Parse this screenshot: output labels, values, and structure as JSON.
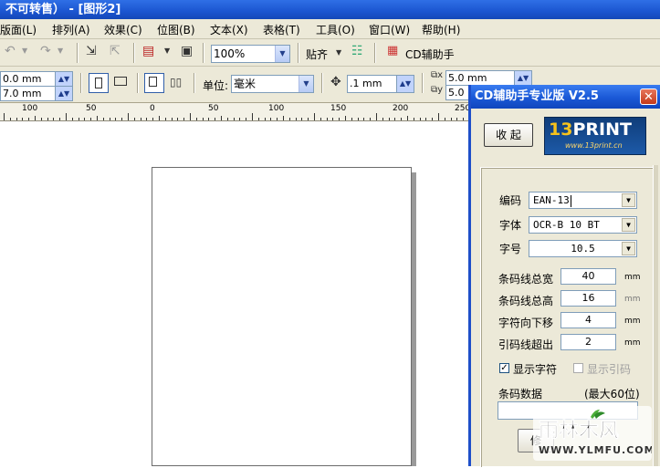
{
  "window": {
    "title": "不可转售） - [图形2]"
  },
  "menu": {
    "items": [
      "版面(L)",
      "排列(A)",
      "效果(C)",
      "位图(B)",
      "文本(X)",
      "表格(T)",
      "工具(O)",
      "窗口(W)",
      "帮助(H)"
    ]
  },
  "toolbar": {
    "zoom": "100%",
    "snap_label": "贴齐",
    "cd_assistant_label": "CD辅助手"
  },
  "propbar": {
    "x_value": "0.0 mm",
    "y_value": "7.0 mm",
    "unit_label": "单位:",
    "unit_value": "毫米",
    "nudge_value": ".1 mm",
    "dup_x": "5.0 mm",
    "dup_y": "5.0 mm"
  },
  "ruler": {
    "labels": [
      "100",
      "50",
      "0",
      "50",
      "100",
      "150",
      "200",
      "250"
    ]
  },
  "dialog": {
    "title": "CD辅助手专业版 V2.5",
    "collapse_button": "收 起",
    "logo_text": "13PRINT",
    "logo_url": "www.13print.cn",
    "code_label": "编码",
    "code_value": "EAN-13",
    "font_label": "字体",
    "font_value": "OCR-B 10 BT",
    "size_label": "字号",
    "size_value": "10.5",
    "bar_width_label": "条码线总宽",
    "bar_width_value": "40",
    "bar_width_unit": "mm",
    "bar_height_label": "条码线总高",
    "bar_height_value": "16",
    "bar_height_unit": "mm",
    "char_shift_label": "字符向下移",
    "char_shift_value": "4",
    "char_shift_unit": "mm",
    "guard_label": "引码线超出",
    "guard_value": "2",
    "guard_unit": "mm",
    "show_chars_label": "显示字符",
    "show_chars_checked": true,
    "show_guard_label": "显示引码",
    "show_guard_checked": false,
    "data_label": "条码数据",
    "data_limit": "(最大60位)",
    "data_value": "",
    "modify_button": "修"
  },
  "watermark": {
    "text": "雨林木风",
    "url": "WWW.YLMFU.COM"
  }
}
